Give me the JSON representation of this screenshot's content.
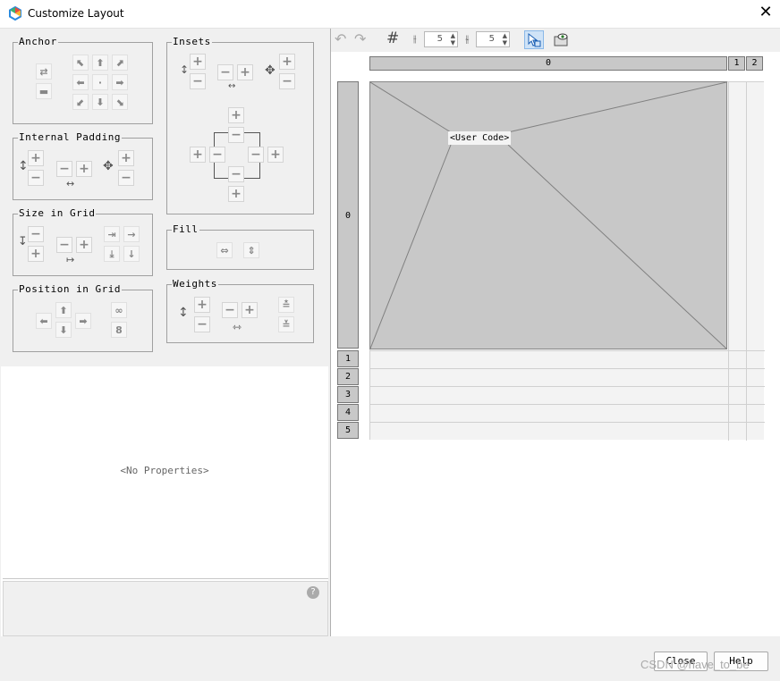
{
  "window": {
    "title": "Customize Layout"
  },
  "groups": {
    "anchor": "Anchor",
    "insets": "Insets",
    "internal_padding": "Internal Padding",
    "size_in_grid": "Size in Grid",
    "fill": "Fill",
    "position_in_grid": "Position in Grid",
    "weights": "Weights"
  },
  "properties": {
    "empty_text": "<No Properties>"
  },
  "toolbar": {
    "hgap_value": "5",
    "vgap_value": "5"
  },
  "grid": {
    "columns": [
      "0",
      "1",
      "2"
    ],
    "rows": [
      "0",
      "1",
      "2",
      "3",
      "4",
      "5"
    ],
    "component_label": "<User Code>"
  },
  "footer": {
    "close_label": "Close",
    "help_label": "Help"
  },
  "watermark": "CSDN @have_to_be"
}
